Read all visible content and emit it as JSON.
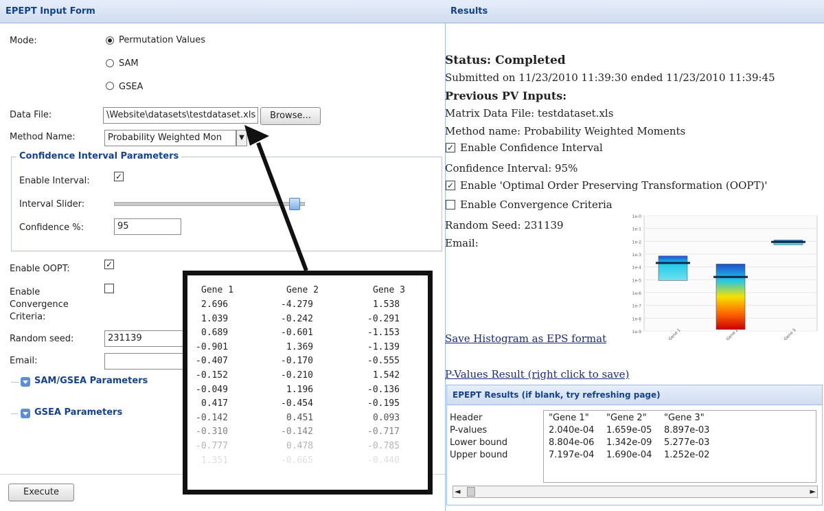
{
  "left": {
    "header": "EPEPT Input Form",
    "mode_label": "Mode:",
    "mode_options": [
      "Permutation Values",
      "SAM",
      "GSEA"
    ],
    "data_file_label": "Data File:",
    "data_file_value": "\\Website\\datasets\\testdataset.xls",
    "browse_label": "Browse...",
    "method_label": "Method Name:",
    "method_value": "Probability Weighted Mon",
    "ci_legend": "Confidence Interval Parameters",
    "enable_interval_label": "Enable Interval:",
    "interval_slider_label": "Interval Slider:",
    "interval_slider_value": 0.95,
    "confidence_label": "Confidence %:",
    "confidence_value": "95",
    "oopt_label": "Enable OOPT:",
    "convergence_label_1": "Enable",
    "convergence_label_2": "Convergence",
    "convergence_label_3": "Criteria:",
    "seed_label": "Random seed:",
    "seed_value": "231139",
    "email_label": "Email:",
    "email_value": "",
    "sam_gsea_label": "SAM/GSEA Parameters",
    "gsea_label": "GSEA Parameters",
    "execute_label": "Execute"
  },
  "table": {
    "headers": [
      "Gene 1",
      "Gene 2",
      "Gene 3"
    ],
    "rows": [
      [
        "2.696",
        "-4.279",
        "1.538"
      ],
      [
        "1.039",
        "-0.242",
        "-0.291"
      ],
      [
        "0.689",
        "-0.601",
        "-1.153"
      ],
      [
        "-0.901",
        "1.369",
        "-1.139"
      ],
      [
        "-0.407",
        "-0.170",
        "-0.555"
      ],
      [
        "-0.152",
        "-0.210",
        "1.542"
      ],
      [
        "-0.049",
        "1.196",
        "-0.136"
      ],
      [
        "0.417",
        "-0.454",
        "-0.195"
      ],
      [
        "-0.142",
        "0.451",
        "0.093"
      ],
      [
        "-0.310",
        "-0.142",
        "-0.717"
      ],
      [
        "-0.777",
        "0.478",
        "-0.785"
      ],
      [
        "1.351",
        "-0.665",
        "-0.440"
      ]
    ]
  },
  "right": {
    "header": "Results",
    "status": "Status: Completed",
    "submitted": "Submitted on 11/23/2010 11:39:30 ended 11/23/2010 11:39:45",
    "prev_inputs": "Previous PV Inputs:",
    "matrix_file": "Matrix Data File: testdataset.xls",
    "method_name": "Method name: Probability Weighted Moments",
    "enable_ci": "Enable Confidence Interval",
    "ci_value": "Confidence Interval: 95%",
    "enable_oopt": "Enable 'Optimal Order Preserving Transformation (OOPT)'",
    "enable_conv": "Enable Convergence Criteria",
    "random_seed": "Random Seed: 231139",
    "email": "Email:",
    "save_hist": "Save Histogram as EPS format",
    "pvalues_link": "P-Values Result (right click to save)",
    "results_header": "EPEPT Results (if blank, try refreshing page)",
    "results_rows": [
      {
        "label": "Header",
        "values": [
          "\"Gene 1\"",
          "\"Gene 2\"",
          "\"Gene 3\""
        ]
      },
      {
        "label": "P-values",
        "values": [
          "2.040e-04",
          "1.659e-05",
          "8.897e-03"
        ]
      },
      {
        "label": "Lower bound",
        "values": [
          "8.804e-06",
          "1.342e-09",
          "5.277e-03"
        ]
      },
      {
        "label": "Upper bound",
        "values": [
          "7.197e-04",
          "1.690e-04",
          "1.252e-02"
        ]
      }
    ]
  },
  "chart_data": {
    "type": "bar",
    "categories": [
      "Gene 1",
      "Gene 2",
      "Gene 3"
    ],
    "y_ticks": [
      "1e-0",
      "1e-1",
      "1e-2",
      "1e-3",
      "1e-4",
      "1e-5",
      "1e-6",
      "1e-7",
      "1e-8",
      "1e-9"
    ],
    "log_scale": true,
    "ylim": [
      1e-09,
      1
    ],
    "p_values": [
      0.000204,
      1.659e-05,
      0.008897
    ],
    "lower_bound": [
      8.804e-06,
      1.342e-09,
      0.005277
    ],
    "upper_bound": [
      0.0007197,
      0.000169,
      0.01252
    ],
    "grid": true
  }
}
